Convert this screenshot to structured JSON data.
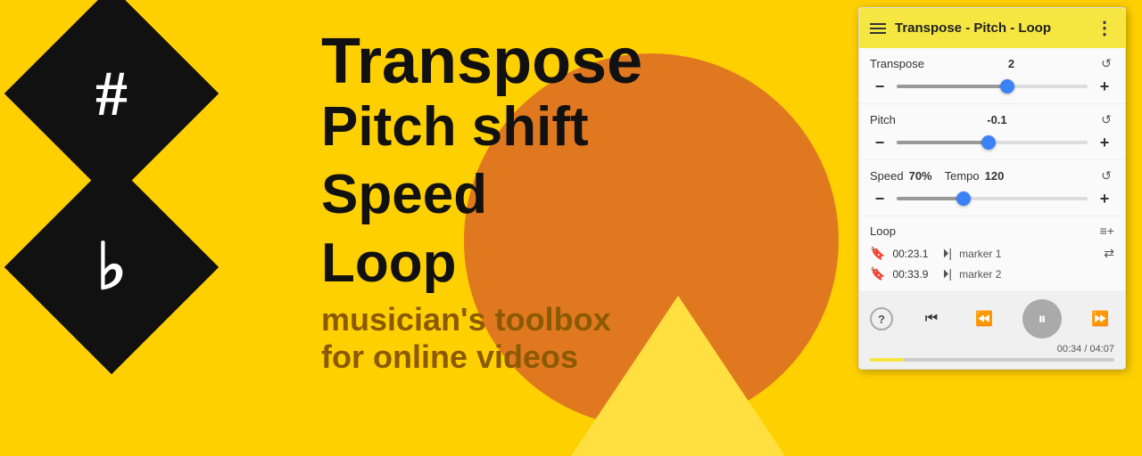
{
  "background": {
    "color": "#FFD000"
  },
  "icons": {
    "sharp_symbol": "#",
    "flat_symbol": "♭"
  },
  "hero_text": {
    "line1": "Transpose",
    "line2": "Pitch shift",
    "line3": "Speed",
    "line4": "Loop",
    "tagline_line1": "musician's toolbox",
    "tagline_line2": "for online videos"
  },
  "panel": {
    "title": "Transpose - Pitch - Loop",
    "more_icon": "⋮",
    "transpose": {
      "label": "Transpose",
      "value": "2",
      "slider_pct": 58
    },
    "pitch": {
      "label": "Pitch",
      "value": "-0.1",
      "slider_pct": 48
    },
    "speed": {
      "label": "Speed",
      "value": "70%",
      "tempo_label": "Tempo",
      "tempo_value": "120",
      "slider_pct": 35
    },
    "loop": {
      "label": "Loop",
      "markers": [
        {
          "time": "00:23.1",
          "name": "marker 1"
        },
        {
          "time": "00:33.9",
          "name": "marker 2"
        }
      ]
    },
    "player": {
      "time_current": "00:34",
      "time_total": "04:07",
      "progress_pct": 14
    }
  }
}
